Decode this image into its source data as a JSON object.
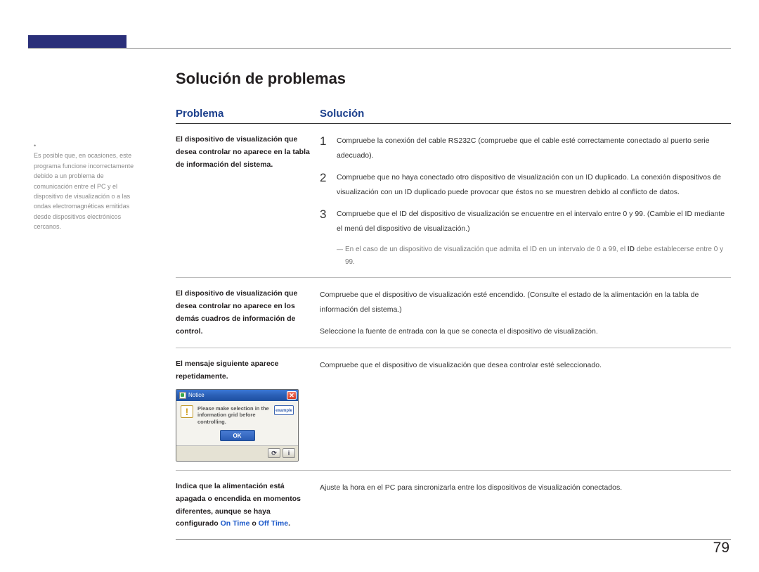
{
  "pageNumber": "79",
  "sidenote": {
    "bullet": "•",
    "text": "Es posible que, en ocasiones, este programa funcione incorrectamente debido a un problema de comunicación entre el PC y el dispositivo de visualización o a las ondas electromagnéticas emitidas desde dispositivos electrónicos cercanos."
  },
  "title": "Solución de problemas",
  "heads": {
    "problema": "Problema",
    "solucion": "Solución"
  },
  "row1": {
    "problem": "El dispositivo de visualización que desea controlar no aparece en la tabla de información del sistema.",
    "steps": [
      {
        "n": "1",
        "t": "Compruebe la conexión del cable RS232C (compruebe que el cable esté correctamente conectado al puerto serie adecuado)."
      },
      {
        "n": "2",
        "t": "Compruebe que no haya conectado otro dispositivo de visualización con un ID duplicado. La conexión dispositivos de visualización con un ID duplicado puede provocar que éstos no se muestren debido al conflicto de datos."
      },
      {
        "n": "3",
        "t": "Compruebe que el ID del dispositivo de visualización se encuentre en el intervalo entre 0 y 99. (Cambie el ID mediante el menú del dispositivo de visualización.)"
      }
    ],
    "subnote_pre": "En el caso de un dispositivo de visualización que admita el ID en un intervalo de 0 a 99, el ",
    "subnote_bold": "ID",
    "subnote_post": " debe establecerse entre 0 y 99."
  },
  "row2": {
    "problem": "El dispositivo de visualización que desea controlar no aparece en los demás cuadros de información de control.",
    "sol1": "Compruebe que el dispositivo de visualización esté encendido. (Consulte el estado de la alimentación en la tabla de información del sistema.)",
    "sol2": "Seleccione la fuente de entrada con la que se conecta el dispositivo de visualización."
  },
  "row3": {
    "problem": "El mensaje siguiente aparece repetidamente.",
    "sol": "Compruebe que el dispositivo de visualización que desea controlar esté seleccionado.",
    "dialog": {
      "title": "Notice",
      "msg": "Please make selection in the information grid before controlling.",
      "example": "example",
      "ok": "OK",
      "btn1": "⟳",
      "btn2": "i"
    }
  },
  "row4": {
    "problem_pre": "Indica que la alimentación está apagada o encendida en momentos diferentes, aunque se haya configurado ",
    "ontime": "On Time",
    "o": " o ",
    "offtime": "Off Time",
    "dot": ".",
    "sol": "Ajuste la hora en el PC para sincronizarla entre los dispositivos de visualización conectados."
  }
}
